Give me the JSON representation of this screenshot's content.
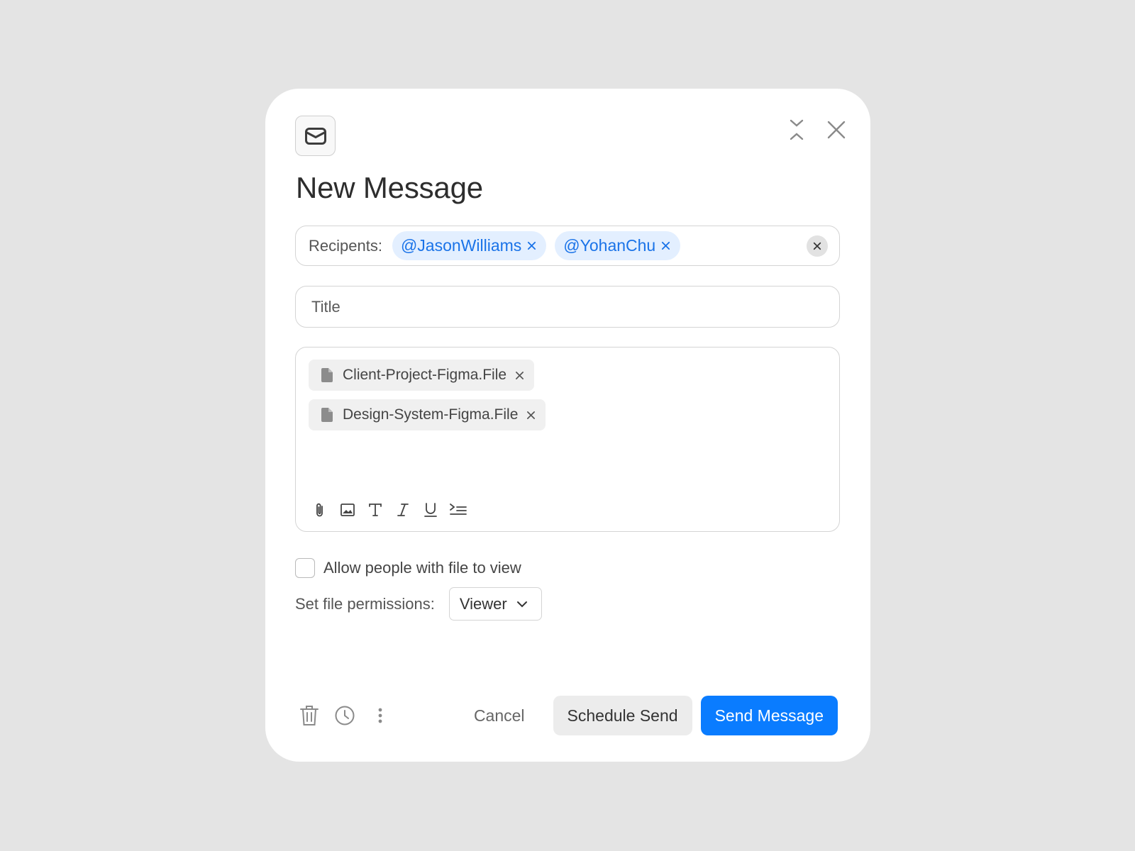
{
  "dialog": {
    "title": "New Message",
    "icons": {
      "badge": "mail-icon",
      "collapse": "collapse-icon",
      "close": "close-icon"
    }
  },
  "recipients": {
    "label": "Recipents:",
    "chips": [
      {
        "name": "@JasonWilliams"
      },
      {
        "name": "@YohanChu"
      }
    ]
  },
  "title_field": {
    "placeholder": "Title",
    "value": ""
  },
  "attachments": [
    {
      "name": "Client-Project-Figma.File",
      "icon": "file-icon"
    },
    {
      "name": "Design-System-Figma.File",
      "icon": "file-icon"
    }
  ],
  "toolbar": [
    "paperclip-icon",
    "image-icon",
    "text-icon",
    "italic-icon",
    "underline-icon",
    "indent-icon"
  ],
  "options": {
    "allow_label": "Allow people with file to view",
    "allow_checked": false,
    "permissions_label": "Set file permissions:",
    "permissions_value": "Viewer"
  },
  "footer": {
    "cancel": "Cancel",
    "schedule": "Schedule Send",
    "send": "Send Message"
  },
  "colors": {
    "accent": "#0a7cff",
    "chip_bg": "#e3efff",
    "chip_text": "#1a73e8",
    "background": "#e4e4e4"
  }
}
